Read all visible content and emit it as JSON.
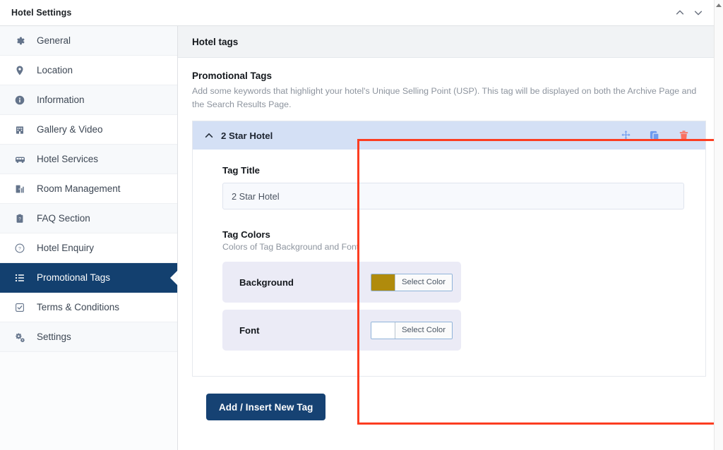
{
  "window": {
    "title": "Hotel Settings",
    "controls": [
      {
        "name": "collapse-up",
        "glyph": "chevron-up"
      },
      {
        "name": "expand-down",
        "glyph": "chevron-down"
      }
    ]
  },
  "sidebar": {
    "items": [
      {
        "label": "General",
        "icon": "gear-icon",
        "active": false
      },
      {
        "label": "Location",
        "icon": "map-pin-icon",
        "active": false
      },
      {
        "label": "Information",
        "icon": "info-circle-icon",
        "active": false
      },
      {
        "label": "Gallery & Video",
        "icon": "building-icon",
        "active": false
      },
      {
        "label": "Hotel Services",
        "icon": "shuttle-bus-icon",
        "active": false
      },
      {
        "label": "Room Management",
        "icon": "room-door-icon",
        "active": false
      },
      {
        "label": "FAQ Section",
        "icon": "clipboard-question-icon",
        "active": false
      },
      {
        "label": "Hotel Enquiry",
        "icon": "question-circle-icon",
        "active": false
      },
      {
        "label": "Promotional Tags",
        "icon": "list-icon",
        "active": true
      },
      {
        "label": "Terms & Conditions",
        "icon": "checkbox-icon",
        "active": false
      },
      {
        "label": "Settings",
        "icon": "gears-icon",
        "active": false
      }
    ]
  },
  "content": {
    "header": "Hotel tags",
    "section_title": "Promotional Tags",
    "section_desc": "Add some keywords that highlight your hotel's Unique Selling Point (USP). This tag will be displayed on both the Archive Page and the Search Results Page."
  },
  "tag": {
    "header_label": "2 Star Hotel",
    "caret": "chevron-up",
    "actions": [
      {
        "name": "move-handle-icon",
        "color": "#6f9bee"
      },
      {
        "name": "duplicate-icon",
        "color": "#6f9bee"
      },
      {
        "name": "delete-icon",
        "color": "#fa7060"
      }
    ],
    "title_label": "Tag Title",
    "title_value": "2 Star Hotel",
    "title_placeholder": "Tag Title",
    "colors_label": "Tag Colors",
    "colors_desc": "Colors of Tag Background and Font",
    "color_rows": [
      {
        "name": "Background",
        "swatch": "#b08b0c",
        "button": "Select Color"
      },
      {
        "name": "Font",
        "swatch": "#ffffff",
        "button": "Select Color"
      }
    ]
  },
  "footer": {
    "add_button": "Add / Insert New Tag"
  },
  "theme": {
    "accent_navy": "#164273",
    "panel_blue": "#d4e0f5",
    "highlight_red": "#fc3d21",
    "row_lavender": "#ebebf6"
  }
}
